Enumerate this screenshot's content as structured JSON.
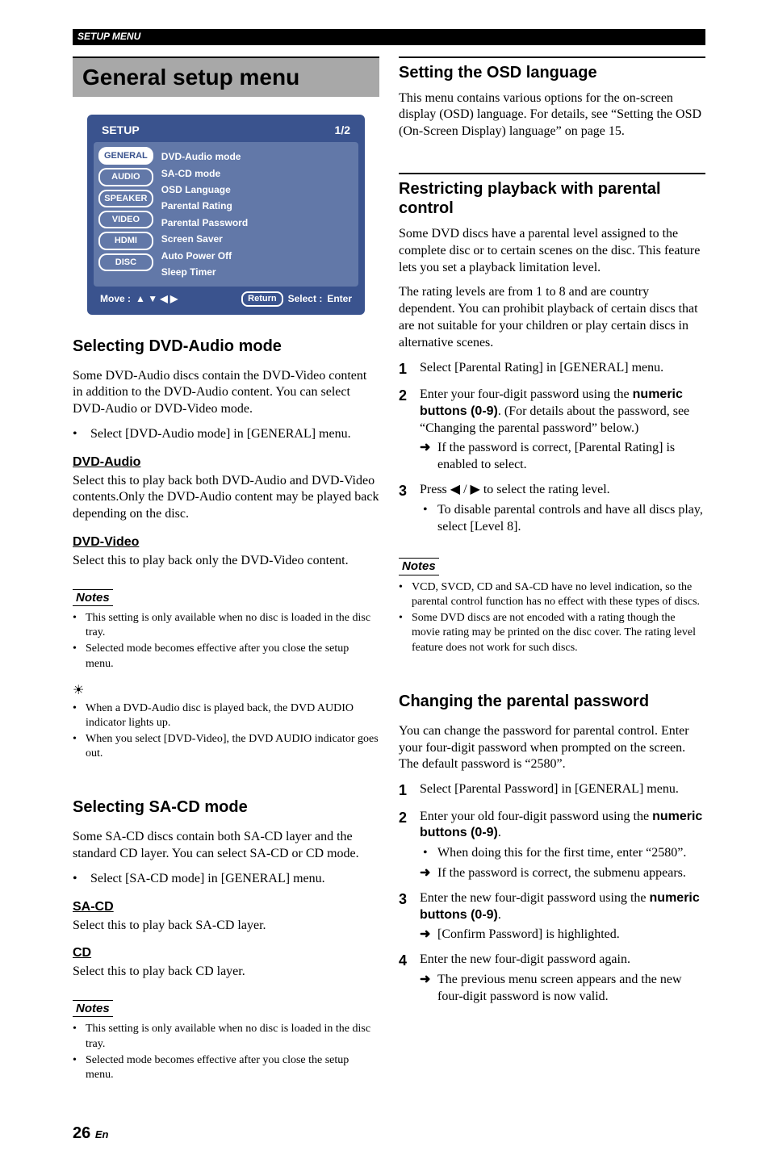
{
  "header": {
    "section_label": "SETUP MENU"
  },
  "title": "General setup menu",
  "setup_panel": {
    "title": "SETUP",
    "page": "1/2",
    "tabs": [
      "GENERAL",
      "AUDIO",
      "SPEAKER",
      "VIDEO",
      "HDMI",
      "DISC"
    ],
    "items": [
      "DVD-Audio mode",
      "SA-CD mode",
      "OSD Language",
      "Parental Rating",
      "Parental Password",
      "Screen Saver",
      "Auto Power Off",
      "Sleep Timer"
    ],
    "footer": {
      "move": "Move :",
      "arrows": "▲ ▼ ◀ ▶",
      "return": "Return",
      "select": "Select :",
      "enter": "Enter"
    }
  },
  "left": {
    "dvd_audio": {
      "heading": "Selecting DVD-Audio mode",
      "intro": "Some DVD-Audio discs contain the DVD-Video content in addition to the DVD-Audio content. You can select DVD-Audio or DVD-Video mode.",
      "step1": "Select [DVD-Audio mode] in [GENERAL] menu.",
      "sub1_head": "DVD-Audio",
      "sub1_text": "Select this to play back both DVD-Audio and DVD-Video contents.Only the DVD-Audio content may be played back depending on the disc.",
      "sub2_head": "DVD-Video",
      "sub2_text": "Select this to play back only the DVD-Video content.",
      "notes_label": "Notes",
      "notes": [
        "This setting is only available when no disc is loaded in the disc tray.",
        "Selected mode becomes effective after you close the setup menu."
      ],
      "hint_icon": "☀",
      "hints": [
        "When a DVD-Audio disc is played back, the DVD AUDIO indicator lights up.",
        "When you select [DVD-Video], the DVD AUDIO indicator goes out."
      ]
    },
    "sacd": {
      "heading": "Selecting SA-CD mode",
      "intro": "Some SA-CD discs contain both SA-CD layer and the standard CD layer. You can select SA-CD or CD mode.",
      "step1": "Select [SA-CD mode] in [GENERAL] menu.",
      "sub1_head": "SA-CD",
      "sub1_text": "Select this to play back SA-CD layer.",
      "sub2_head": "CD",
      "sub2_text": "Select this to play back CD layer.",
      "notes_label": "Notes",
      "notes": [
        "This setting is only available when no disc is loaded in the disc tray.",
        "Selected mode becomes effective after you close the setup menu."
      ]
    }
  },
  "right": {
    "osd": {
      "heading": "Setting the OSD language",
      "text": "This menu contains various options for the on-screen display (OSD) language. For details, see “Setting the OSD (On-Screen Display) language” on page 15."
    },
    "parental": {
      "heading": "Restricting playback with parental control",
      "p1": "Some DVD discs have a parental level assigned to the complete disc or to certain scenes on the disc. This feature lets you set a playback limitation level.",
      "p2": "The rating levels are from 1 to 8 and are country dependent. You can prohibit playback of certain discs that are not suitable for your children or play certain discs in alternative scenes.",
      "steps": {
        "s1": "Select [Parental Rating] in [GENERAL] menu.",
        "s2a": "Enter your four-digit password using the ",
        "s2b": "numeric buttons (0-9)",
        "s2c": ". (For details about the password, see “Changing the parental password” below.)",
        "s2_arrow": "If the password is correct, [Parental Rating] is enabled to select.",
        "s3a": "Press ",
        "s3b": "◀ / ▶",
        "s3c": " to select the rating level.",
        "s3_bullet": "To disable parental controls and have all discs play, select [Level 8]."
      },
      "notes_label": "Notes",
      "notes": [
        "VCD, SVCD, CD and SA-CD have no level indication, so the parental control function has no effect with these types of discs.",
        "Some DVD discs are not encoded with a rating though the movie rating may be printed on the disc cover. The rating level feature does not work for such discs."
      ]
    },
    "password": {
      "heading": "Changing the parental password",
      "intro": "You can change the password for parental control. Enter your four-digit password when prompted on the screen. The default password is “2580”.",
      "steps": {
        "s1": "Select [Parental Password] in [GENERAL] menu.",
        "s2a": "Enter your old four-digit password using the ",
        "s2b": "numeric buttons (0-9)",
        "s2c": ".",
        "s2_bullet": "When doing this for the first time, enter “2580”.",
        "s2_arrow": "If the password is correct, the submenu appears.",
        "s3a": "Enter the new four-digit password using the ",
        "s3b": "numeric buttons (0-9)",
        "s3c": ".",
        "s3_arrow": "[Confirm Password] is highlighted.",
        "s4": "Enter the new four-digit password again.",
        "s4_arrow": "The previous menu screen appears and the new four-digit password is now valid."
      }
    }
  },
  "footer": {
    "page": "26",
    "lang": "En"
  }
}
